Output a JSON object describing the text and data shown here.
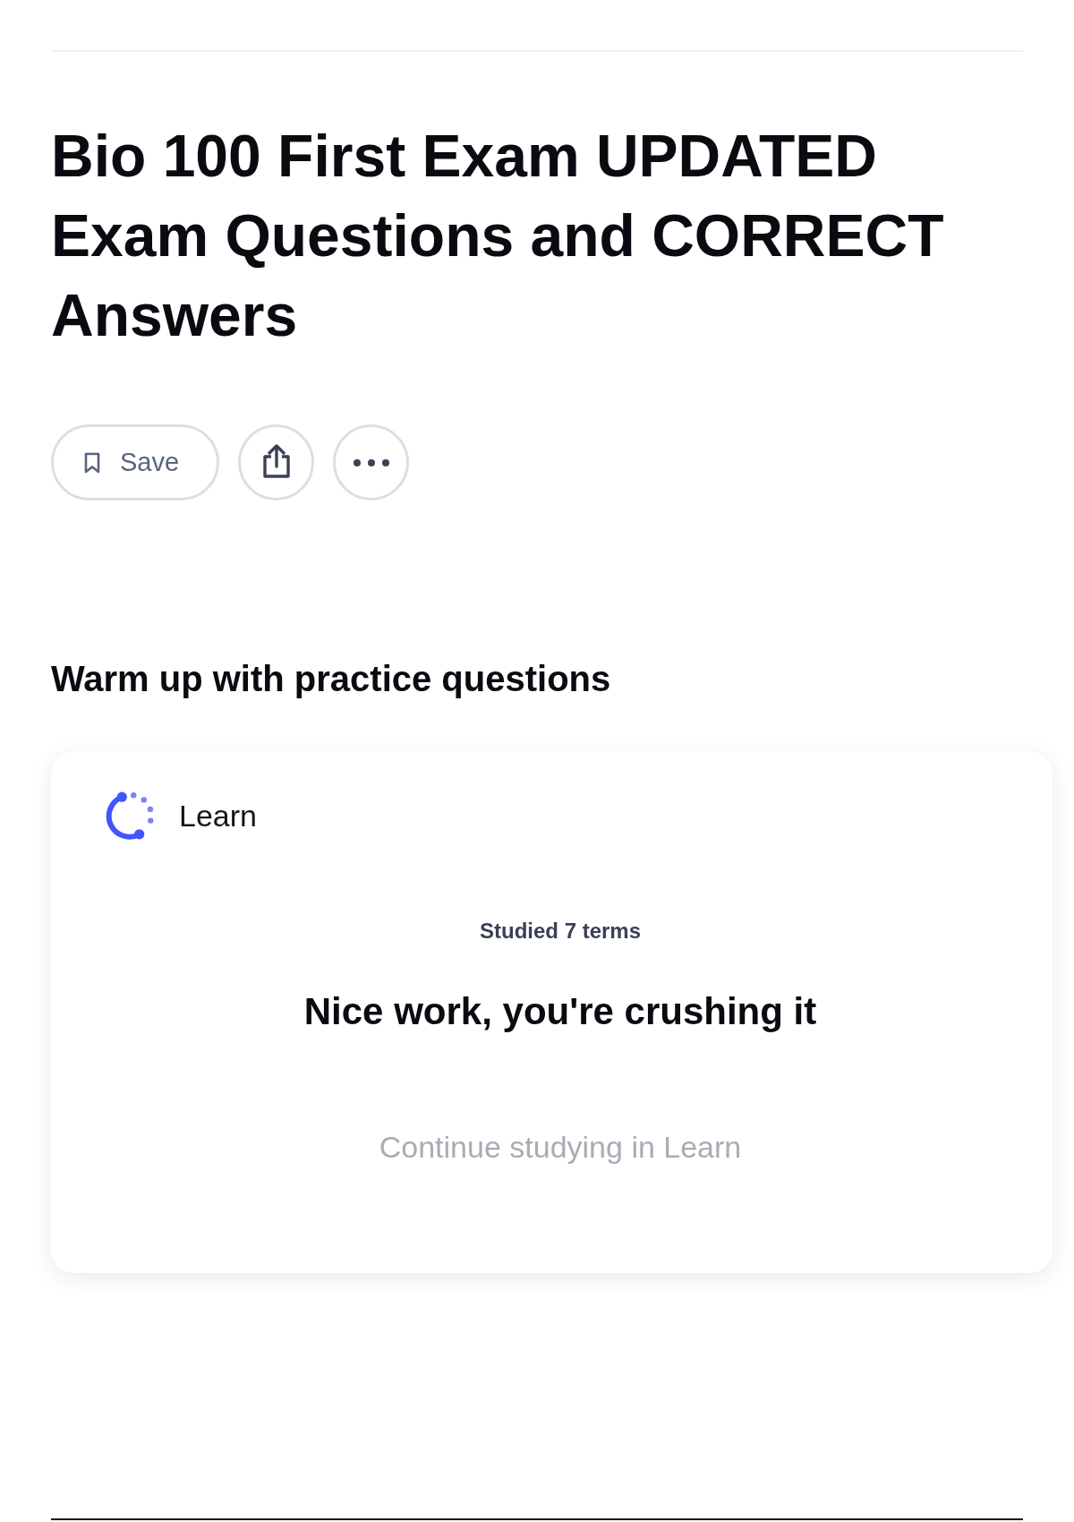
{
  "title": "Bio 100 First Exam UPDATED Exam Questions and CORRECT Answers",
  "actions": [
    {
      "kind": "save",
      "label": "Save"
    },
    {
      "kind": "share"
    },
    {
      "kind": "more"
    }
  ],
  "practice": {
    "heading": "Warm up with practice questions",
    "card": {
      "mode": "Learn",
      "progress": "Studied 7 terms",
      "message": "Nice work, you're crushing it",
      "link": "Continue studying in Learn"
    }
  }
}
